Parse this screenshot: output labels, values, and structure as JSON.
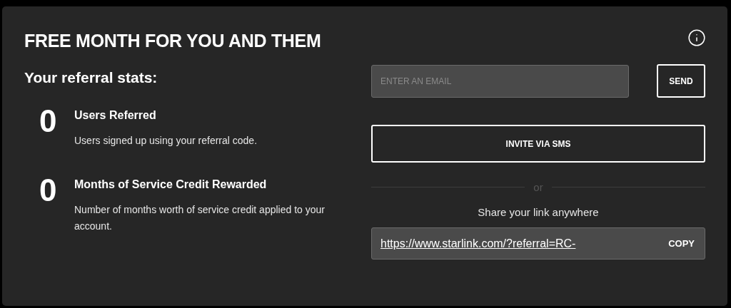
{
  "title": "FREE MONTH FOR YOU AND THEM",
  "stats_heading": "Your referral stats:",
  "stats": [
    {
      "value": "0",
      "label": "Users Referred",
      "description": "Users signed up using your referral code."
    },
    {
      "value": "0",
      "label": "Months of Service Credit Rewarded",
      "description": "Number of months worth of service credit applied to your account."
    }
  ],
  "email": {
    "placeholder": "ENTER AN EMAIL"
  },
  "send_button": "SEND",
  "sms_button": "INVITE VIA SMS",
  "divider": "or",
  "share_label": "Share your link anywhere",
  "share_link": {
    "url": "https://www.starlink.com/?referral=RC-",
    "copy": "COPY"
  }
}
